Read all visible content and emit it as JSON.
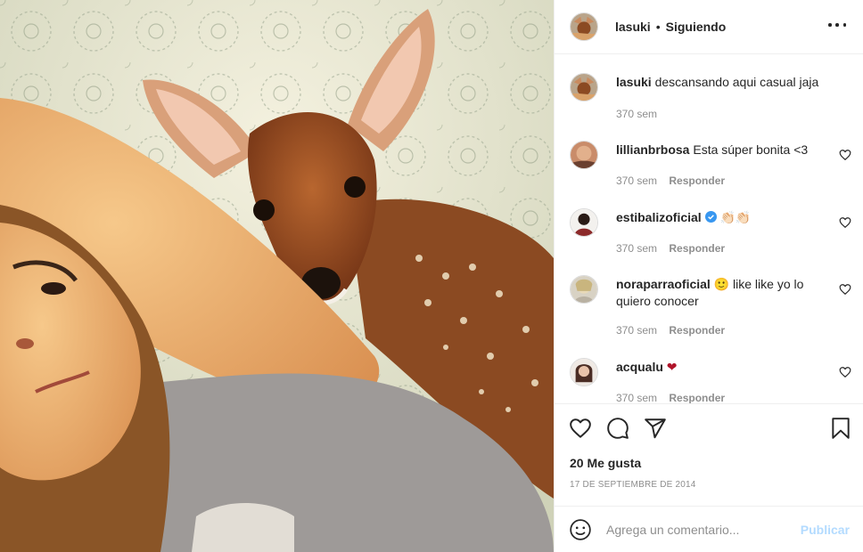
{
  "post_author": {
    "username": "lasuki",
    "separator": "•",
    "follow_status": "Siguiendo",
    "avatar_icon": "avatar-lasuki"
  },
  "caption": {
    "username": "lasuki",
    "text": "descansando aqui casual jaja",
    "time": "370 sem"
  },
  "comments": [
    {
      "username": "lillianbrbosa",
      "text": "Esta súper bonita <3",
      "time": "370 sem",
      "reply_label": "Responder",
      "avatar_color": "#c98c6a"
    },
    {
      "username": "estibalizoficial",
      "verified": true,
      "text": "👏🏻👏🏻",
      "time": "370 sem",
      "reply_label": "Responder",
      "avatar_color": "#8c2a2a"
    },
    {
      "username": "noraparraoficial",
      "text": "🙂 like like yo lo quiero conocer",
      "time": "370 sem",
      "reply_label": "Responder",
      "avatar_color": "#b9b1a2"
    },
    {
      "username": "acqualu",
      "text": "❤",
      "time": "370 sem",
      "reply_label": "Responder",
      "avatar_color": "#8a6e66"
    }
  ],
  "actions": {
    "likes": "20 Me gusta",
    "date": "17 DE SEPTIEMBRE DE 2014"
  },
  "add_comment": {
    "placeholder": "Agrega un comentario...",
    "publish_label": "Publicar"
  },
  "colors": {
    "text": "#262626",
    "secondary": "#8e8e8e",
    "border": "#efefef",
    "publish_disabled": "#b3dbff",
    "verified": "#3897f0",
    "heart_red": "#ed4956"
  }
}
